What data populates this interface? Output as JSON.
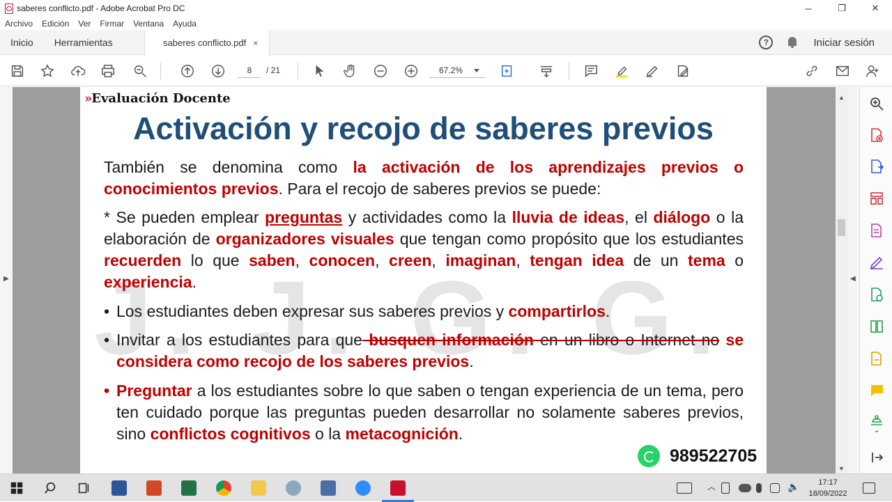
{
  "window": {
    "title": "saberes conflicto.pdf - Adobe Acrobat Pro DC",
    "minimize": "─",
    "maximize": "❐",
    "close": "✕"
  },
  "menu": [
    "Archivo",
    "Edición",
    "Ver",
    "Firmar",
    "Ventana",
    "Ayuda"
  ],
  "tabs": {
    "home": "Inicio",
    "tools": "Herramientas",
    "doc": "saberes conflicto.pdf",
    "doc_close": "×",
    "help": "?",
    "signin": "Iniciar sesión"
  },
  "toolbar": {
    "page_current": "8",
    "page_total": "/ 21",
    "zoom": "67.2%"
  },
  "slide": {
    "brand_chev": "»",
    "brand": "Evaluación Docente",
    "title": "Activación y recojo de saberes previos",
    "watermark": "J. J. G. G.",
    "p1": {
      "a": "También se denomina como ",
      "b": "la activación de los aprendizajes previos o conocimientos previos",
      "c": ". Para el recojo de saberes previos se puede:"
    },
    "p2": {
      "a": "* Se pueden emplear ",
      "b": "preguntas",
      "c": " y actividades como la ",
      "d": "lluvia de ideas",
      "e": ", el ",
      "f": "diálogo",
      "g": " o la elaboración de ",
      "h": "organizadores visuales",
      "i": " que tengan como propósito que los estudiantes ",
      "j": "recuerden",
      "k": " lo que ",
      "l": "saben",
      "m": ", ",
      "n": "conocen",
      "o": ", ",
      "p": "creen",
      "q": ", ",
      "r": "imaginan",
      "s": ", ",
      "t": "tengan idea",
      "u": " de un ",
      "v": "tema",
      "w": " o ",
      "x": "experiencia",
      "y": "."
    },
    "b1": {
      "bullet": "•",
      "a": "Los estudiantes deben expresar sus saberes previos y ",
      "b": "compartirlos",
      "c": "."
    },
    "b2": {
      "bullet": "•",
      "a": "Invitar a los estudiantes para que",
      "b": " busquen información",
      "c": " en un libro o Internet no",
      "d": " se considera como recojo de los saberes previos",
      "e": "."
    },
    "b3": {
      "bullet": "•",
      "a": "Preguntar",
      "b": " a los estudiantes sobre lo que saben o tengan experiencia de un tema, pero ten cuidado porque las preguntas pueden desarrollar no solamente saberes previos, sino ",
      "c": "conflictos cognitivos",
      "d": " o la ",
      "e": "metacognición",
      "f": "."
    },
    "phone": "989522705"
  },
  "taskbar": {
    "time": "17:17",
    "date": "18/09/2022"
  },
  "colors": {
    "title": "#1f4e79",
    "accent_red": "#c00000",
    "acrobat_red": "#c8102e"
  }
}
